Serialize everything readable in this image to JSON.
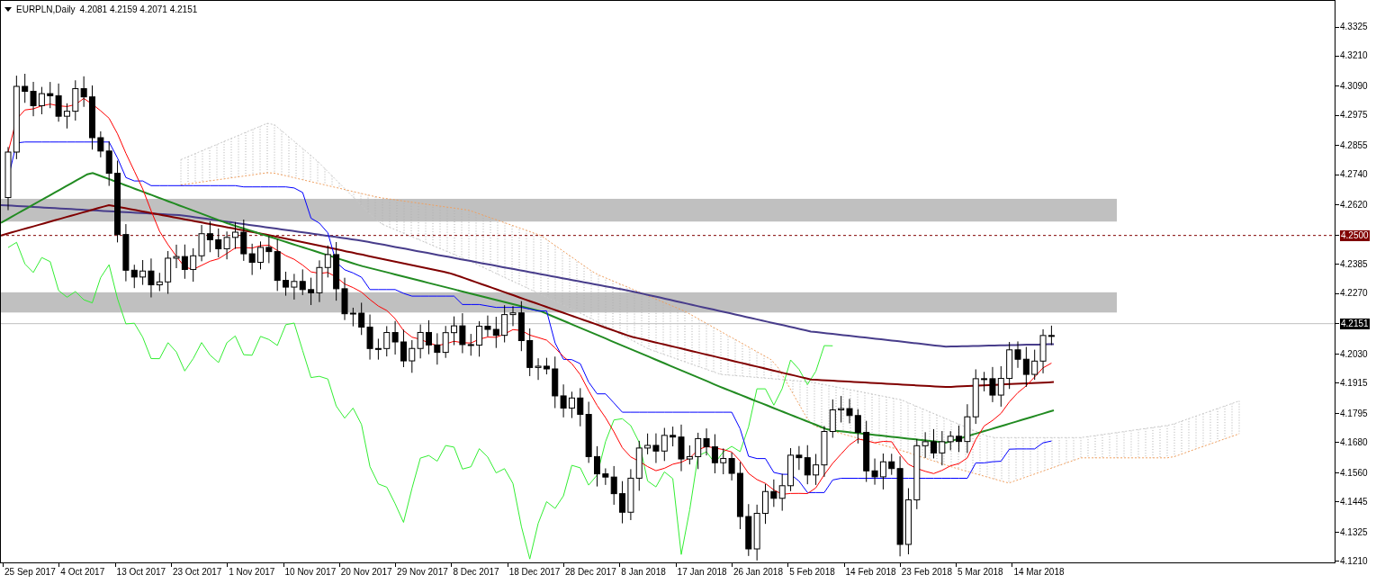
{
  "header": {
    "symbol": "EURPLN,Daily",
    "ohlc": "4.2081 4.2159 4.2071 4.2151"
  },
  "price_axis": [
    {
      "label": "4.3325",
      "kind": "tick"
    },
    {
      "label": "4.3210",
      "kind": "tick"
    },
    {
      "label": "4.3090",
      "kind": "tick"
    },
    {
      "label": "4.2975",
      "kind": "tick"
    },
    {
      "label": "4.2855",
      "kind": "tick"
    },
    {
      "label": "4.2740",
      "kind": "tick"
    },
    {
      "label": "4.2620",
      "kind": "tick"
    },
    {
      "label": "4.2500",
      "kind": "level"
    },
    {
      "label": "4.2385",
      "kind": "tick"
    },
    {
      "label": "4.2270",
      "kind": "tick"
    },
    {
      "label": "4.2151",
      "kind": "current"
    },
    {
      "label": "4.2030",
      "kind": "tick"
    },
    {
      "label": "4.1915",
      "kind": "tick"
    },
    {
      "label": "4.1795",
      "kind": "tick"
    },
    {
      "label": "4.1680",
      "kind": "tick"
    },
    {
      "label": "4.1560",
      "kind": "tick"
    },
    {
      "label": "4.1445",
      "kind": "tick"
    },
    {
      "label": "4.1325",
      "kind": "tick"
    },
    {
      "label": "4.1210",
      "kind": "tick"
    }
  ],
  "time_axis": [
    "25 Sep 2017",
    "4 Oct 2017",
    "13 Oct 2017",
    "23 Oct 2017",
    "1 Nov 2017",
    "10 Nov 2017",
    "20 Nov 2017",
    "29 Nov 2017",
    "8 Dec 2017",
    "18 Dec 2017",
    "28 Dec 2017",
    "8 Jan 2018",
    "17 Jan 2018",
    "26 Jan 2018",
    "5 Feb 2018",
    "14 Feb 2018",
    "23 Feb 2018",
    "5 Mar 2018",
    "14 Mar 2018"
  ]
}
